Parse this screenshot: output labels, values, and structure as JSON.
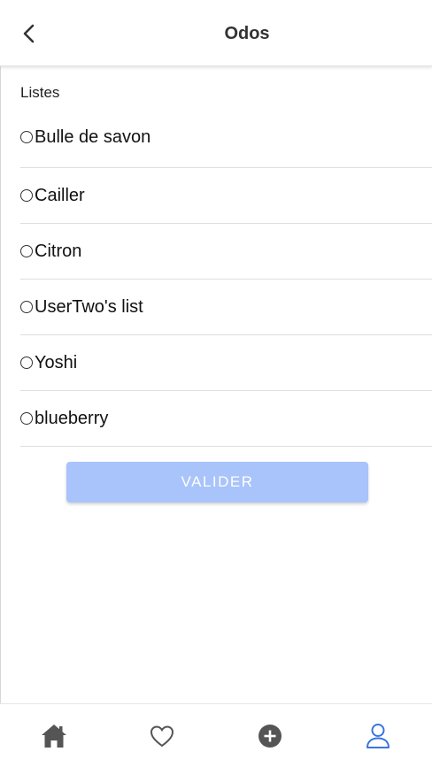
{
  "header": {
    "title": "Odos",
    "back_icon": "chevron-left-icon"
  },
  "section": {
    "label": "Listes"
  },
  "lists": [
    {
      "label": "Bulle de savon",
      "selected": false
    },
    {
      "label": "Cailler",
      "selected": false
    },
    {
      "label": "Citron",
      "selected": false
    },
    {
      "label": "UserTwo's list",
      "selected": false
    },
    {
      "label": "Yoshi",
      "selected": false
    },
    {
      "label": "blueberry",
      "selected": false
    }
  ],
  "submit": {
    "label": "VALIDER",
    "enabled": false
  },
  "bottom_nav": {
    "items": [
      {
        "icon": "home-icon",
        "active": false
      },
      {
        "icon": "heart-icon",
        "active": false
      },
      {
        "icon": "add-circle-icon",
        "active": false
      },
      {
        "icon": "user-icon",
        "active": true
      }
    ]
  },
  "colors": {
    "accent": "#3a74e0",
    "icon_gray": "#555555",
    "button_disabled": "#a9c3fb"
  }
}
